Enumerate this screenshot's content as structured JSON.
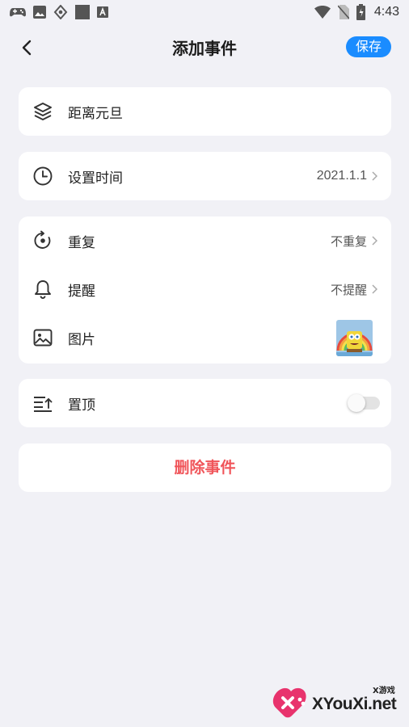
{
  "status_bar": {
    "time": "4:43",
    "left_icons": [
      "gamepad-icon",
      "image-icon",
      "settings-icon",
      "square-icon",
      "a-icon"
    ],
    "right_icons": [
      "wifi-icon",
      "no-sim-icon",
      "battery-icon"
    ]
  },
  "nav": {
    "title": "添加事件",
    "save_label": "保存",
    "accent": "#1a8cff"
  },
  "event_name": {
    "label": "距离元旦",
    "icon": "layers-icon"
  },
  "time": {
    "label": "设置时间",
    "value": "2021.1.1",
    "icon": "clock-icon"
  },
  "options": [
    {
      "label": "重复",
      "value": "不重复",
      "icon": "repeat-icon"
    },
    {
      "label": "提醒",
      "value": "不提醒",
      "icon": "bell-icon"
    },
    {
      "label": "图片",
      "icon": "picture-icon"
    }
  ],
  "pin": {
    "label": "置顶",
    "icon": "pin-top-icon",
    "enabled": false
  },
  "delete": {
    "label": "删除事件",
    "color": "#f0555a"
  },
  "watermark": {
    "text": "XYouXi.net",
    "small": "X游戏"
  }
}
